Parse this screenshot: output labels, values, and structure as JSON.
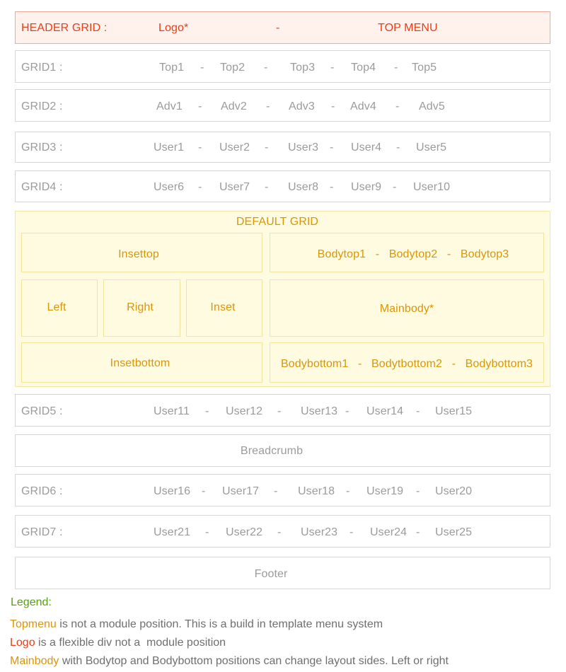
{
  "header": {
    "label": "HEADER GRID :",
    "logo": "Logo*",
    "sep": "-",
    "top_menu": "TOP MENU"
  },
  "rows": [
    {
      "label": "GRID1 :",
      "items": [
        "Top1",
        "Top2",
        "Top3",
        "Top4",
        "Top5"
      ]
    },
    {
      "label": "GRID2 :",
      "items": [
        "Adv1",
        "Adv2",
        "Adv3",
        "Adv4",
        "Adv5"
      ]
    },
    {
      "label": "GRID3 :",
      "items": [
        "User1",
        "User2",
        "User3",
        "User4",
        "User5"
      ]
    },
    {
      "label": "GRID4 :",
      "items": [
        "User6",
        "User7",
        "User8",
        "User9",
        "User10"
      ]
    }
  ],
  "default_grid": {
    "title": "DEFAULT GRID",
    "insettop": "Insettop",
    "bodytop": "Bodytop1   -   Bodytop2   -   Bodytop3",
    "left": "Left",
    "right": "Right",
    "inset": "Inset",
    "mainbody": "Mainbody*",
    "insetbottom": "Insetbottom",
    "bodybottom": "Bodybottom1   -   Bodytbottom2   -   Bodybottom3"
  },
  "rows_lower": [
    {
      "label": "GRID5 :",
      "items": [
        "User11",
        "User12",
        "User13",
        "User14",
        "User15"
      ]
    }
  ],
  "breadcrumb": "Breadcrumb",
  "rows_bottom": [
    {
      "label": "GRID6 :",
      "items": [
        "User16",
        "User17",
        "User18",
        "User19",
        "User20"
      ]
    },
    {
      "label": "GRID7 :",
      "items": [
        "User21",
        "User22",
        "User23",
        "User24",
        "User25"
      ]
    }
  ],
  "footer": "Footer",
  "legend": {
    "title": "Legend:",
    "line1_key": "Topmenu",
    "line1_text": " is not a module position. This is a build in template menu system",
    "line2_key": "Logo",
    "line2_text": " is a flexible div not a  module position",
    "line3_key": "Mainbody",
    "line3_text": " with Bodytop and Bodybottom positions can change layout sides. Left or right"
  },
  "separator": "-",
  "colors": {
    "header_text": "#e8401a",
    "header_bg": "#fff1ec",
    "default_text": "#d9960a",
    "default_bg": "#fffbe0",
    "grid_text": "#9b9b9b",
    "legend_title": "#55a20f"
  }
}
